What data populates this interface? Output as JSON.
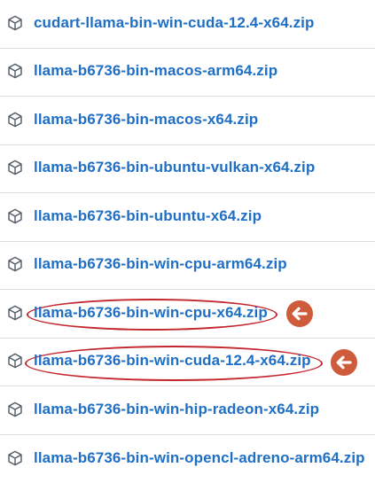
{
  "assets": [
    {
      "name": "cudart-llama-bin-win-cuda-12.4-x64.zip"
    },
    {
      "name": "llama-b6736-bin-macos-arm64.zip"
    },
    {
      "name": "llama-b6736-bin-macos-x64.zip"
    },
    {
      "name": "llama-b6736-bin-ubuntu-vulkan-x64.zip"
    },
    {
      "name": "llama-b6736-bin-ubuntu-x64.zip"
    },
    {
      "name": "llama-b6736-bin-win-cpu-arm64.zip"
    },
    {
      "name": "llama-b6736-bin-win-cpu-x64.zip",
      "highlighted": true
    },
    {
      "name": "llama-b6736-bin-win-cuda-12.4-x64.zip",
      "highlighted": true
    },
    {
      "name": "llama-b6736-bin-win-hip-radeon-x64.zip"
    },
    {
      "name": "llama-b6736-bin-win-opencl-adreno-arm64.zip"
    }
  ],
  "icon": "package-icon",
  "colors": {
    "link": "#1f6fc5",
    "icon": "#57606a",
    "divider": "#d8dee4",
    "highlight_ring": "#c4262e",
    "arrow_marker": "#cf5b3d"
  }
}
